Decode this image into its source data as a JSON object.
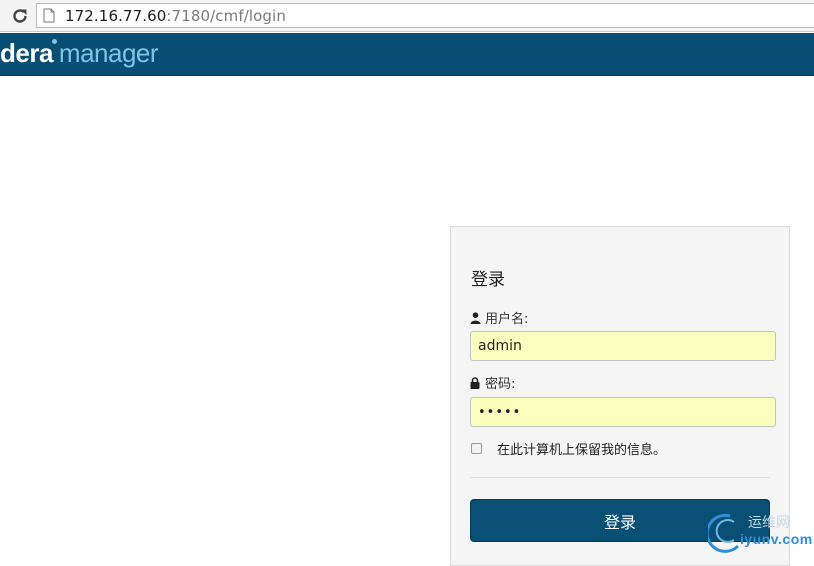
{
  "browser": {
    "url_host": "172.16.77.60",
    "url_path": ":7180/cmf/login",
    "reload_icon": "reload-icon",
    "page_icon": "document-icon"
  },
  "app": {
    "brand_part1": "dera",
    "brand_part2": "manager"
  },
  "login": {
    "title": "登录",
    "username_label": "用户名:",
    "username_value": "admin",
    "password_label": "密码:",
    "password_value": "•••••",
    "remember_label": "在此计算机上保留我的信息。",
    "remember_checked": false,
    "submit_label": "登录"
  },
  "watermark": {
    "cn": "运维网",
    "en": "iyunv.com"
  },
  "colors": {
    "header_bg": "#094e73",
    "button_bg": "#0a4f74",
    "input_bg": "#fbffbe",
    "panel_bg": "#f5f5f5"
  }
}
